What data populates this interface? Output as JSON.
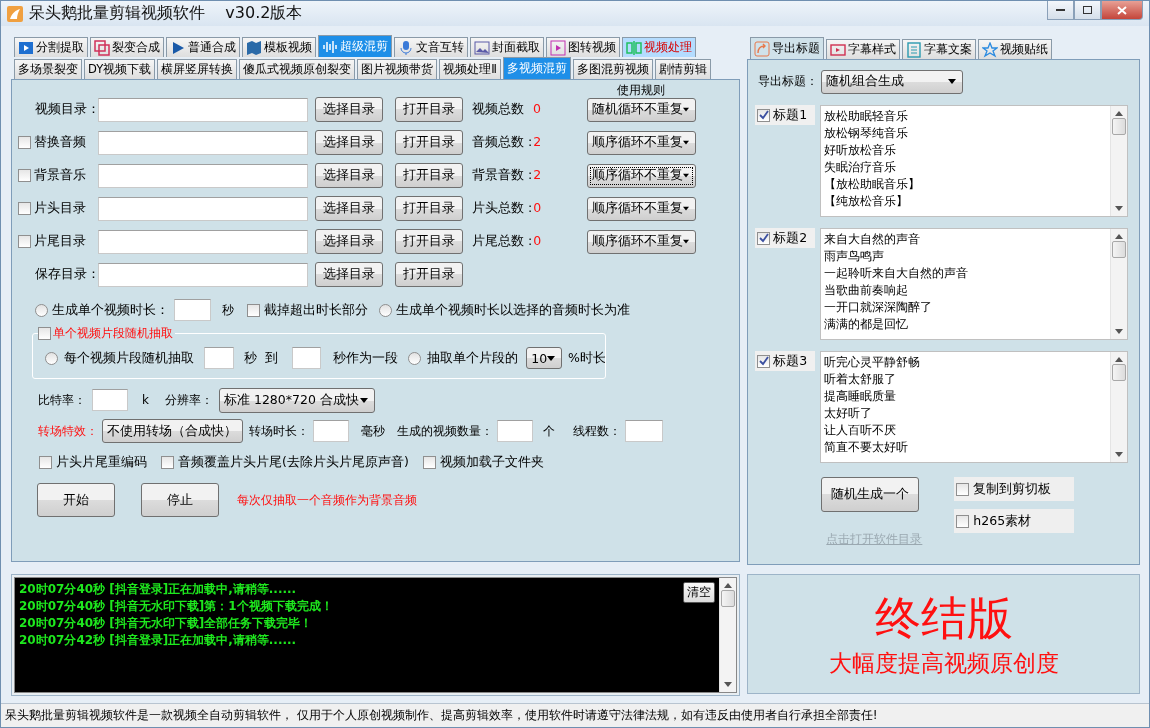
{
  "window": {
    "title": "呆头鹅批量剪辑视频软件    v30.2版本"
  },
  "top_tabs": [
    {
      "label": "分割提取",
      "selected": false,
      "red_text": false
    },
    {
      "label": "裂变合成",
      "selected": false,
      "red_text": false
    },
    {
      "label": "普通合成",
      "selected": false,
      "red_text": false
    },
    {
      "label": "模板视频",
      "selected": false,
      "red_text": false
    },
    {
      "label": "超级混剪",
      "selected": true,
      "red_text": false
    },
    {
      "label": "文音互转",
      "selected": false,
      "red_text": false
    },
    {
      "label": "封面截取",
      "selected": false,
      "red_text": false
    },
    {
      "label": "图转视频",
      "selected": false,
      "red_text": false
    },
    {
      "label": "视频处理",
      "selected": false,
      "red_text": true
    }
  ],
  "sub_tabs": [
    {
      "label": "多场景裂变",
      "selected": false
    },
    {
      "label": "DY视频下载",
      "selected": false
    },
    {
      "label": "横屏竖屏转换",
      "selected": false
    },
    {
      "label": "傻瓜式视频原创裂变",
      "selected": false
    },
    {
      "label": "图片视频带货",
      "selected": false
    },
    {
      "label": "视频处理Ⅱ",
      "selected": false
    },
    {
      "label": "多视频混剪",
      "selected": true
    },
    {
      "label": "多图混剪视频",
      "selected": false
    },
    {
      "label": "剧情剪辑",
      "selected": false
    }
  ],
  "rule_header": "使用规则",
  "directories": [
    {
      "kind": "plain",
      "label": "视频目录：",
      "select_button": "选择目录",
      "open_button": "打开目录",
      "count_label": "视频总数",
      "count": "0",
      "rule": "随机循环不重复",
      "focused": false
    },
    {
      "kind": "checkbox",
      "checked": false,
      "label": "替换音频",
      "select_button": "选择目录",
      "open_button": "打开目录",
      "count_label": "音频总数 :",
      "count": "2",
      "rule": "顺序循环不重复",
      "focused": false
    },
    {
      "kind": "checkbox",
      "checked": false,
      "label": "背景音乐",
      "select_button": "选择目录",
      "open_button": "打开目录",
      "count_label": "背景音数 :",
      "count": "2",
      "rule": "顺序循环不重复",
      "focused": true
    },
    {
      "kind": "checkbox",
      "checked": false,
      "label": "片头目录",
      "select_button": "选择目录",
      "open_button": "打开目录",
      "count_label": "片头总数 :",
      "count": "0",
      "rule": "顺序循环不重复",
      "focused": false
    },
    {
      "kind": "checkbox",
      "checked": false,
      "label": "片尾目录",
      "select_button": "选择目录",
      "open_button": "打开目录",
      "count_label": "片尾总数 :",
      "count": "0",
      "rule": "顺序循环不重复",
      "focused": false
    },
    {
      "kind": "plain",
      "label": "保存目录：",
      "select_button": "选择目录",
      "open_button": "打开目录"
    }
  ],
  "duration_row": {
    "radio_label": "生成单个视频时长：",
    "radio_selected": false,
    "unit": "秒",
    "trim_label": "截掉超出时长部分",
    "trim_checked": false,
    "audio_radio_label": "生成单个视频时长以选择的音频时长为准",
    "audio_radio_selected": false
  },
  "segment_group": {
    "label": "单个视频片段随机抽取",
    "checked": false,
    "random_label": "每个视频片段随机抽取",
    "random_selected": false,
    "to_text": "秒 到",
    "per_text": "秒作为一段",
    "percent_label": "抽取单个片段的",
    "percent_selected": false,
    "percent_value": "10",
    "percent_unit": "%时长"
  },
  "bitrate": {
    "label": "比特率：",
    "unit": "k",
    "resolution_label": "分辨率：",
    "resolution": "标准 1280*720 合成快"
  },
  "transition": {
    "label": "转场特效：",
    "value": "不使用转场（合成快）",
    "duration_label": "转场时长：",
    "duration_unit": "毫秒",
    "count_label": "生成的视频数量：",
    "count_unit": "个",
    "threads_label": "线程数："
  },
  "options": [
    {
      "label": "片头片尾重编码",
      "checked": false
    },
    {
      "label": "音频覆盖片头片尾(去除片头片尾原声音)",
      "checked": false
    },
    {
      "label": "视频加载子文件夹",
      "checked": false
    }
  ],
  "actions": {
    "start": "开始",
    "stop": "停止",
    "note": "每次仅抽取一个音频作为背景音频"
  },
  "right_tabs": [
    {
      "label": "导出标题",
      "selected": true
    },
    {
      "label": "字幕样式",
      "selected": false
    },
    {
      "label": "字幕文案",
      "selected": false
    },
    {
      "label": "视频贴纸",
      "selected": false
    }
  ],
  "export": {
    "label": "导出标题：",
    "value": "随机组合生成"
  },
  "titles": [
    {
      "label": "标题1",
      "checked": true,
      "lines": [
        "放松助眠轻音乐",
        "放松钢琴纯音乐",
        "好听放松音乐",
        "失眠治疗音乐",
        "【放松助眠音乐】",
        "【纯放松音乐】"
      ]
    },
    {
      "label": "标题2",
      "checked": true,
      "lines": [
        "来自大自然的声音",
        "雨声鸟鸣声",
        "一起聆听来自大自然的声音",
        "当歌曲前奏响起",
        "一开口就深深陶醉了",
        "满满的都是回忆"
      ]
    },
    {
      "label": "标题3",
      "checked": true,
      "lines": [
        "听完心灵平静舒畅",
        "听着太舒服了",
        "提高睡眠质量",
        "太好听了",
        "让人百听不厌",
        "简直不要太好听"
      ]
    }
  ],
  "generate_button": "随机生成一个",
  "copy_option": {
    "label": "复制到剪切板",
    "checked": false
  },
  "h265_option": {
    "label": "h265素材",
    "checked": false
  },
  "open_dir_link": "点击打开软件目录",
  "log": {
    "clear_button": "清空",
    "lines": [
      "20时07分40秒 [抖音登录]正在加载中,请稍等......",
      "20时07分40秒 [抖音无水印下载]第：1个视频下载完成！",
      "20时07分40秒 [抖音无水印下载]全部任务下载完毕！",
      "20时07分42秒 [抖音登录]正在加载中,请稍等......"
    ]
  },
  "banner": {
    "title": "终结版",
    "subtitle": "大幅度提高视频原创度"
  },
  "status_bar": "呆头鹅批量剪辑视频软件是一款视频全自动剪辑软件， 仅用于个人原创视频制作、提高剪辑效率，使用软件时请遵守法律法规，如有违反由使用者自行承担全部责任!"
}
